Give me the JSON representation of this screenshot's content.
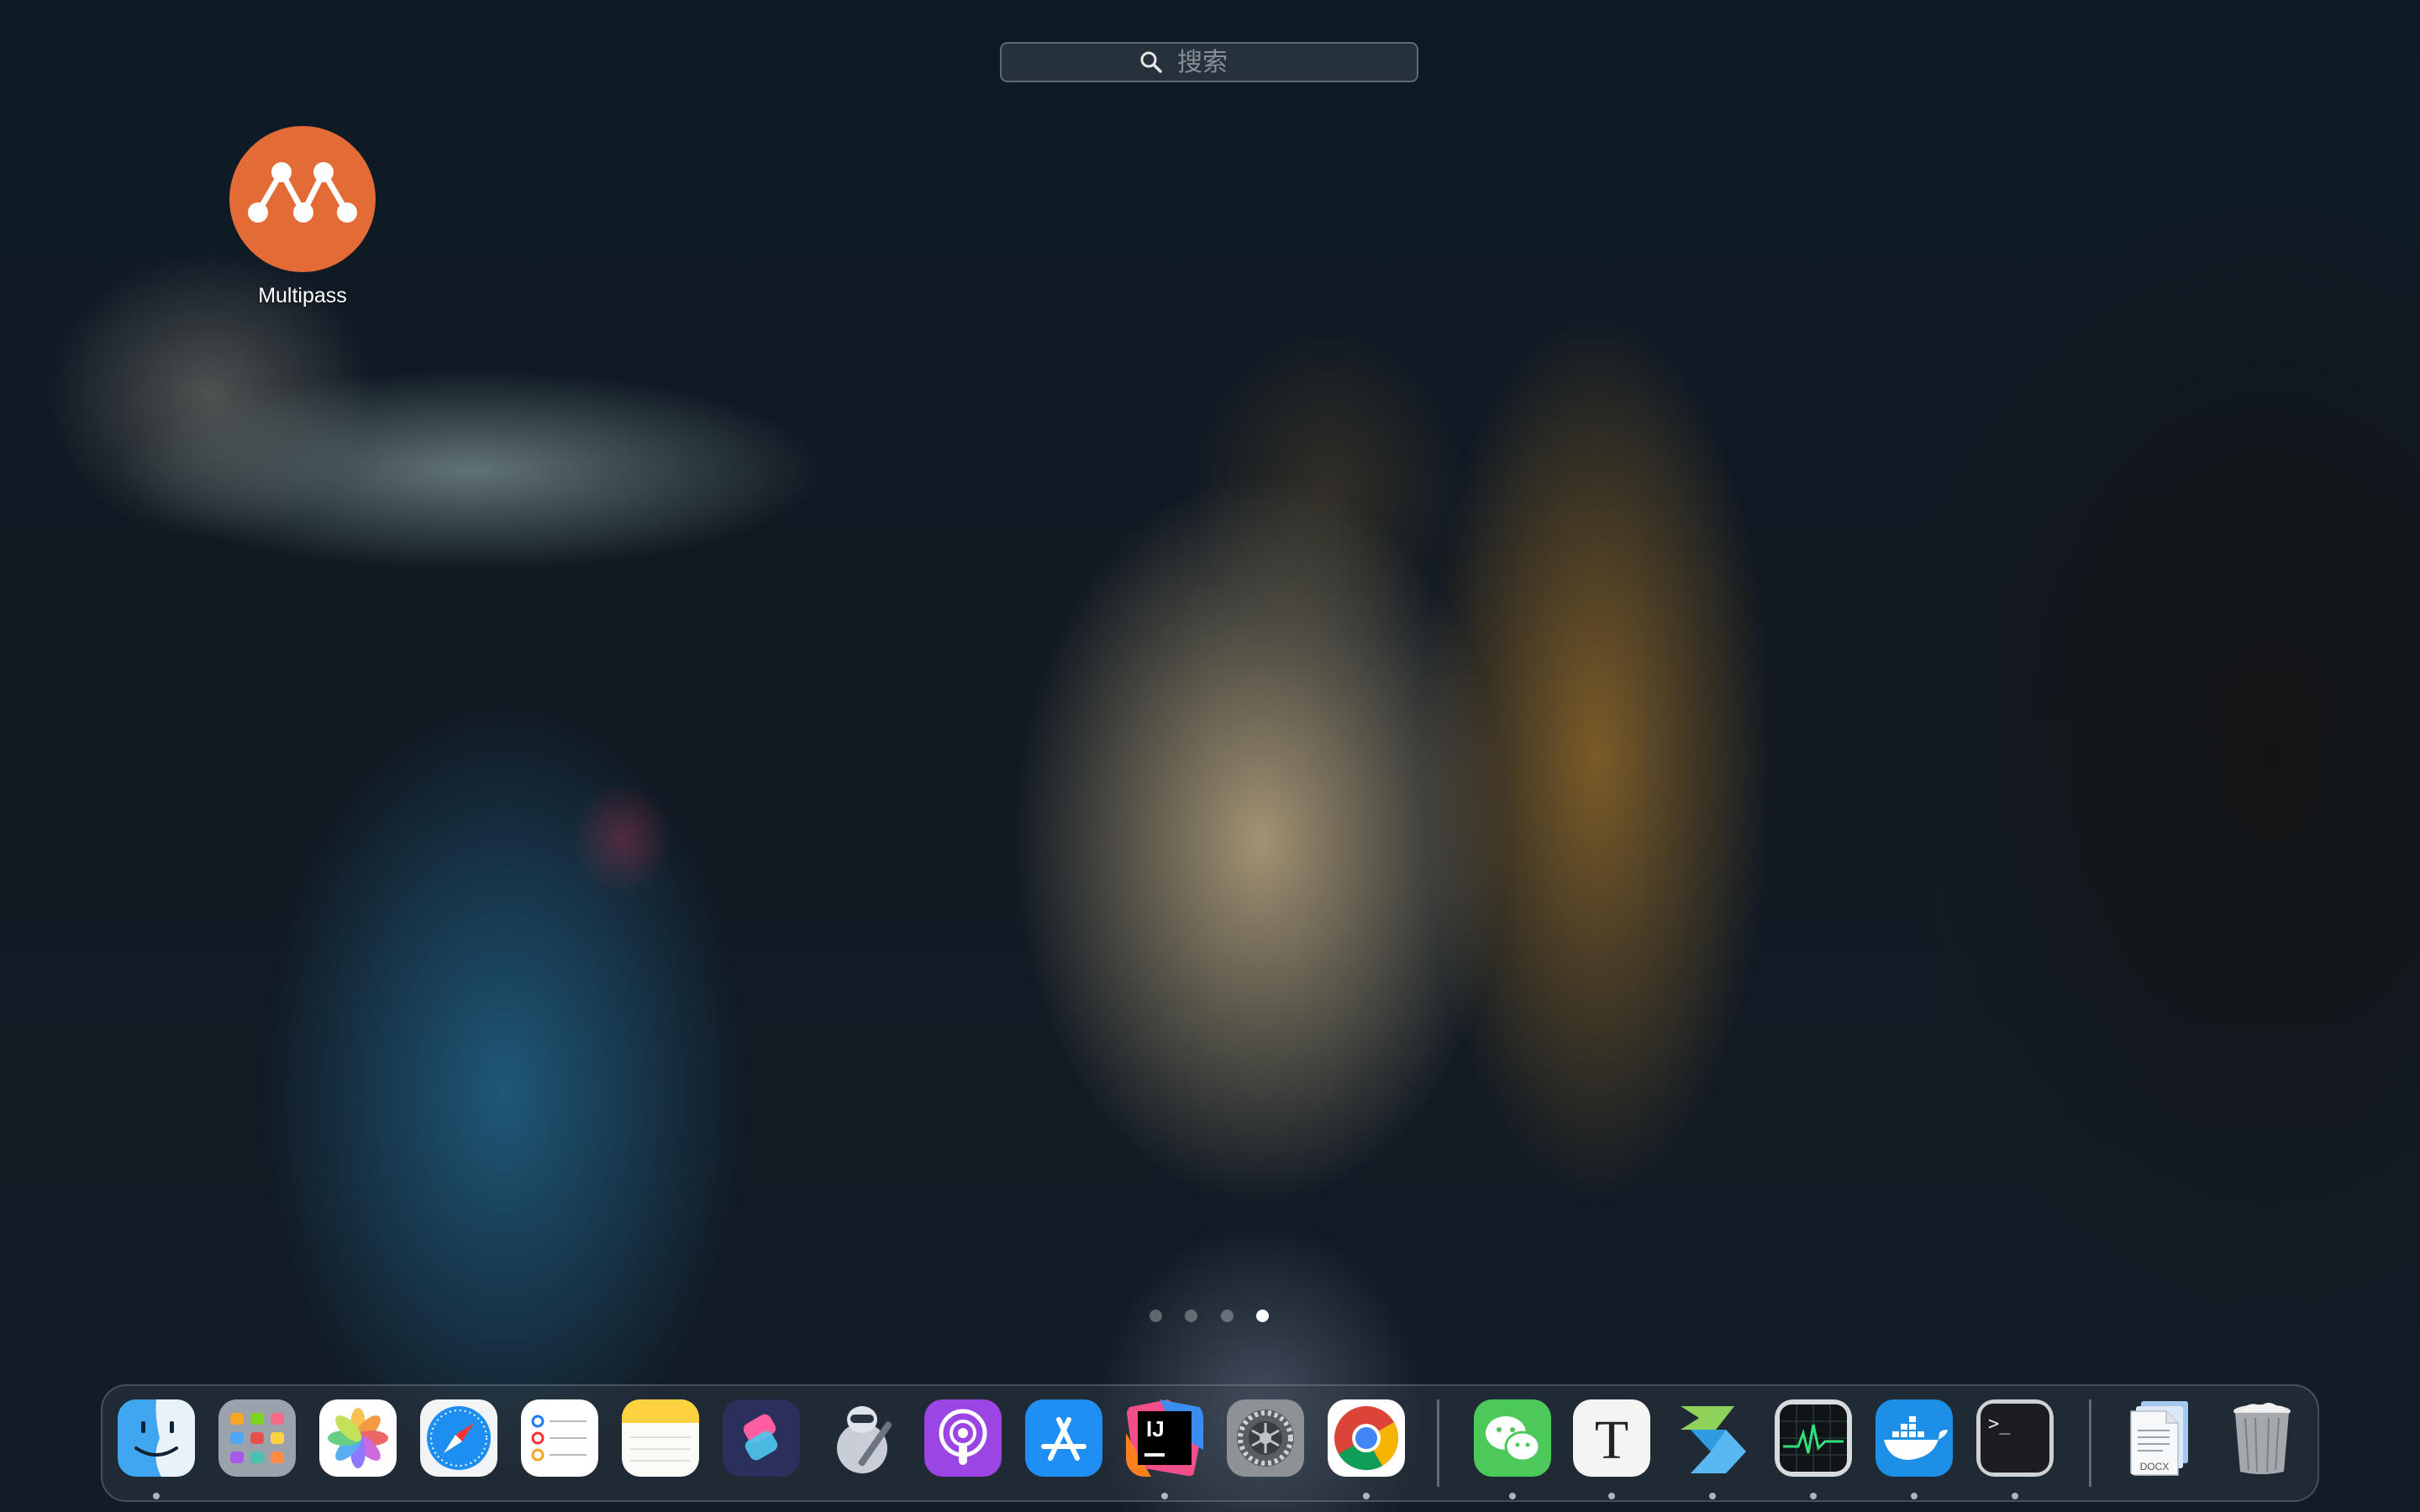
{
  "search": {
    "placeholder": "搜索"
  },
  "app": {
    "name": "Multipass",
    "icon": "multipass-icon",
    "color": "#e36b36"
  },
  "pagination": {
    "total_pages": 4,
    "current_page": 4
  },
  "dock": {
    "apps": [
      {
        "name": "Finder",
        "icon": "finder-icon",
        "running": true
      },
      {
        "name": "Launchpad",
        "icon": "launchpad-icon",
        "running": false
      },
      {
        "name": "Photos",
        "icon": "photos-icon",
        "running": false
      },
      {
        "name": "Safari",
        "icon": "safari-icon",
        "running": false
      },
      {
        "name": "Reminders",
        "icon": "reminders-icon",
        "running": false
      },
      {
        "name": "Notes",
        "icon": "notes-icon",
        "running": false
      },
      {
        "name": "Shortcuts",
        "icon": "shortcuts-icon",
        "running": false
      },
      {
        "name": "Automator",
        "icon": "automator-icon",
        "running": false
      },
      {
        "name": "Podcasts",
        "icon": "podcasts-icon",
        "running": false
      },
      {
        "name": "App Store",
        "icon": "app-store-icon",
        "running": false
      },
      {
        "name": "IntelliJ IDEA",
        "icon": "intellij-icon",
        "icon_text": "IJ",
        "running": true
      },
      {
        "name": "System Settings",
        "icon": "settings-gear-icon",
        "running": false
      },
      {
        "name": "Google Chrome",
        "icon": "chrome-icon",
        "running": true
      },
      {
        "name": "WeChat",
        "icon": "wechat-icon",
        "running": true
      },
      {
        "name": "Typora",
        "icon": "typora-icon",
        "icon_text": "T",
        "running": true
      },
      {
        "name": "Dev tool",
        "icon": "chevrons-icon",
        "running": true
      },
      {
        "name": "Activity Monitor",
        "icon": "activity-monitor-icon",
        "running": true
      },
      {
        "name": "Docker",
        "icon": "docker-icon",
        "running": true
      },
      {
        "name": "Terminal",
        "icon": "terminal-icon",
        "icon_text": ">_",
        "running": true
      }
    ],
    "stack": {
      "name": "Documents",
      "icon": "docx-stack-icon",
      "icon_text": "DOCX"
    },
    "trash": {
      "name": "Trash",
      "icon": "trash-full-icon"
    }
  }
}
